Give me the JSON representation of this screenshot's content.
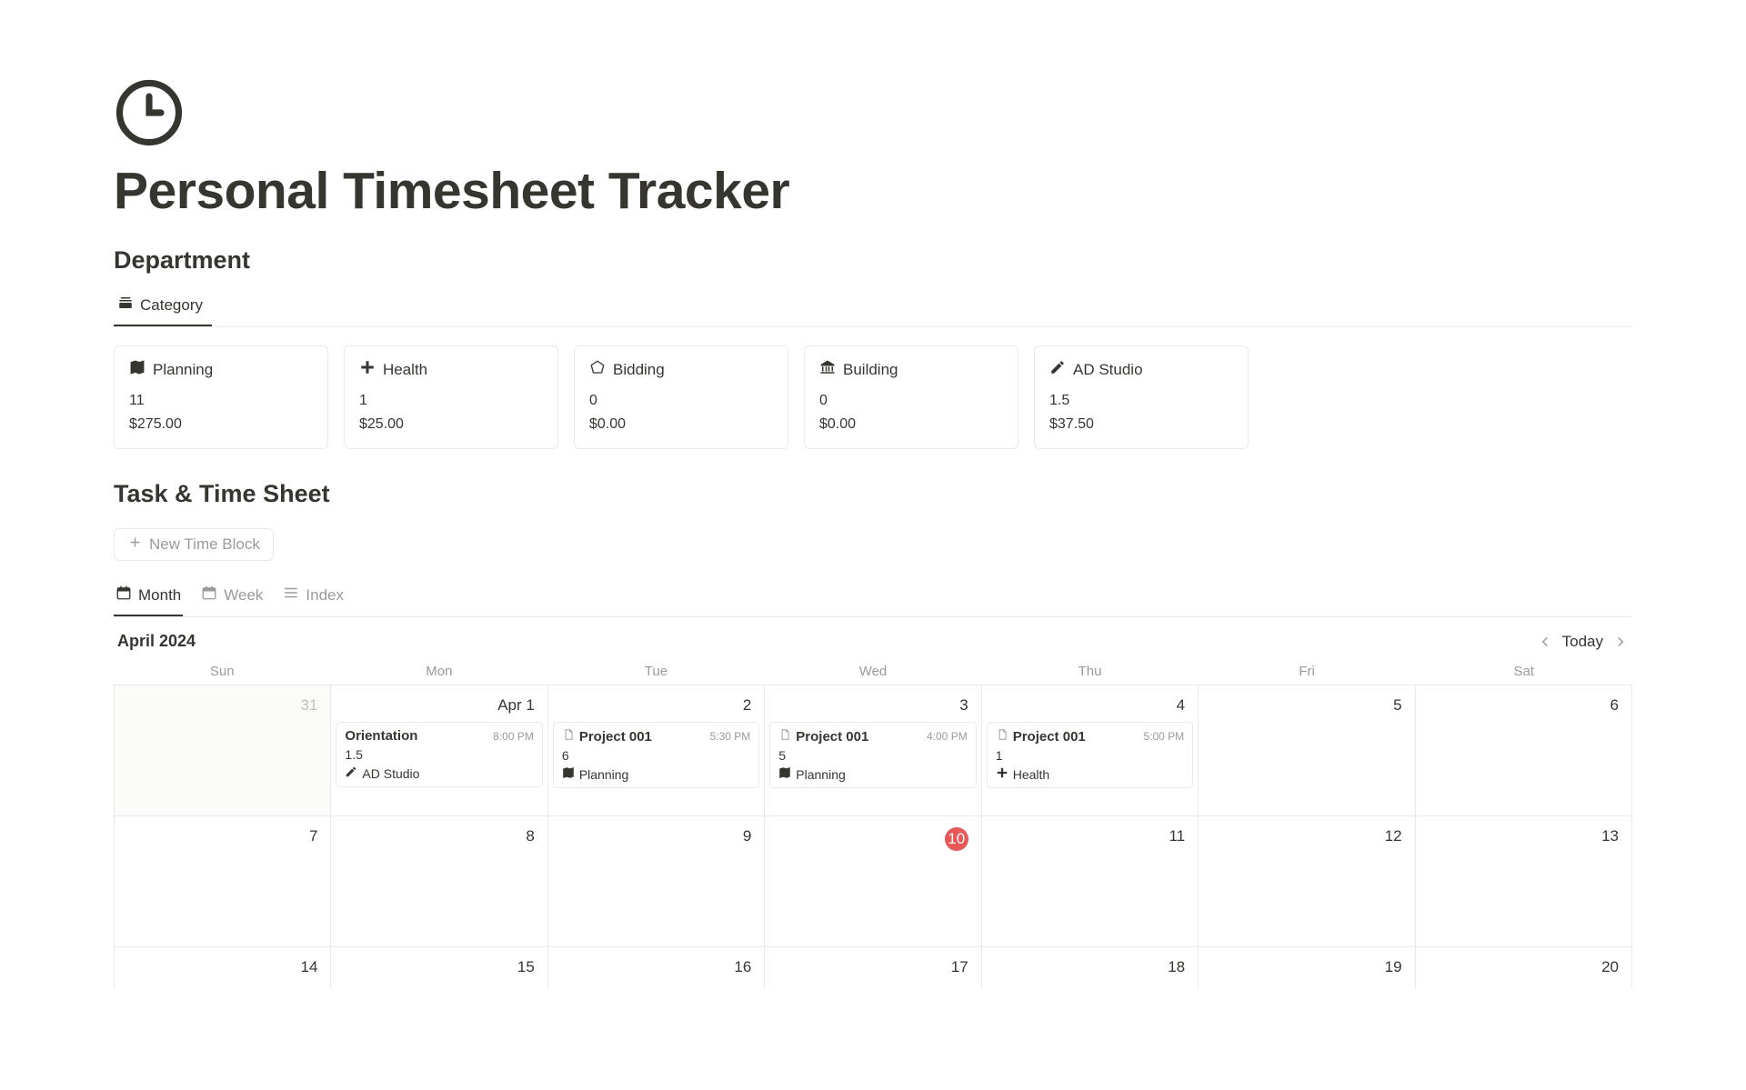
{
  "page_title": "Personal Timesheet Tracker",
  "sections": {
    "department": "Department",
    "task_sheet": "Task & Time Sheet"
  },
  "category_tab": "Category",
  "cards": [
    {
      "icon": "map",
      "name": "Planning",
      "hours": "11",
      "amount": "$275.00"
    },
    {
      "icon": "plus-bold",
      "name": "Health",
      "hours": "1",
      "amount": "$25.00"
    },
    {
      "icon": "pentagon",
      "name": "Bidding",
      "hours": "0",
      "amount": "$0.00"
    },
    {
      "icon": "bank",
      "name": "Building",
      "hours": "0",
      "amount": "$0.00"
    },
    {
      "icon": "pencil",
      "name": "AD Studio",
      "hours": "1.5",
      "amount": "$37.50"
    }
  ],
  "new_time_block": "New Time Block",
  "view_tabs": [
    {
      "icon": "calendar",
      "label": "Month",
      "active": true
    },
    {
      "icon": "calendar",
      "label": "Week",
      "active": false
    },
    {
      "icon": "list",
      "label": "Index",
      "active": false
    }
  ],
  "calendar": {
    "month_label": "April 2024",
    "today_label": "Today",
    "day_names": [
      "Sun",
      "Mon",
      "Tue",
      "Wed",
      "Thu",
      "Fri",
      "Sat"
    ],
    "rows": [
      [
        {
          "label": "31",
          "other_month": true
        },
        {
          "label": "Apr 1",
          "events": [
            {
              "title": "Orientation",
              "time": "8:00 PM",
              "hours": "1.5",
              "cat_icon": "pencil",
              "cat": "AD Studio",
              "doc": false
            }
          ]
        },
        {
          "label": "2",
          "events": [
            {
              "title": "Project 001",
              "time": "5:30 PM",
              "hours": "6",
              "cat_icon": "map",
              "cat": "Planning",
              "doc": true
            }
          ]
        },
        {
          "label": "3",
          "events": [
            {
              "title": "Project 001",
              "time": "4:00 PM",
              "hours": "5",
              "cat_icon": "map",
              "cat": "Planning",
              "doc": true
            }
          ]
        },
        {
          "label": "4",
          "events": [
            {
              "title": "Project 001",
              "time": "5:00 PM",
              "hours": "1",
              "cat_icon": "plus-bold",
              "cat": "Health",
              "doc": true
            }
          ]
        },
        {
          "label": "5"
        },
        {
          "label": "6"
        }
      ],
      [
        {
          "label": "7"
        },
        {
          "label": "8"
        },
        {
          "label": "9"
        },
        {
          "label": "10",
          "today": true
        },
        {
          "label": "11"
        },
        {
          "label": "12"
        },
        {
          "label": "13"
        }
      ],
      [
        {
          "label": "14"
        },
        {
          "label": "15"
        },
        {
          "label": "16"
        },
        {
          "label": "17"
        },
        {
          "label": "18"
        },
        {
          "label": "19"
        },
        {
          "label": "20"
        }
      ]
    ]
  }
}
